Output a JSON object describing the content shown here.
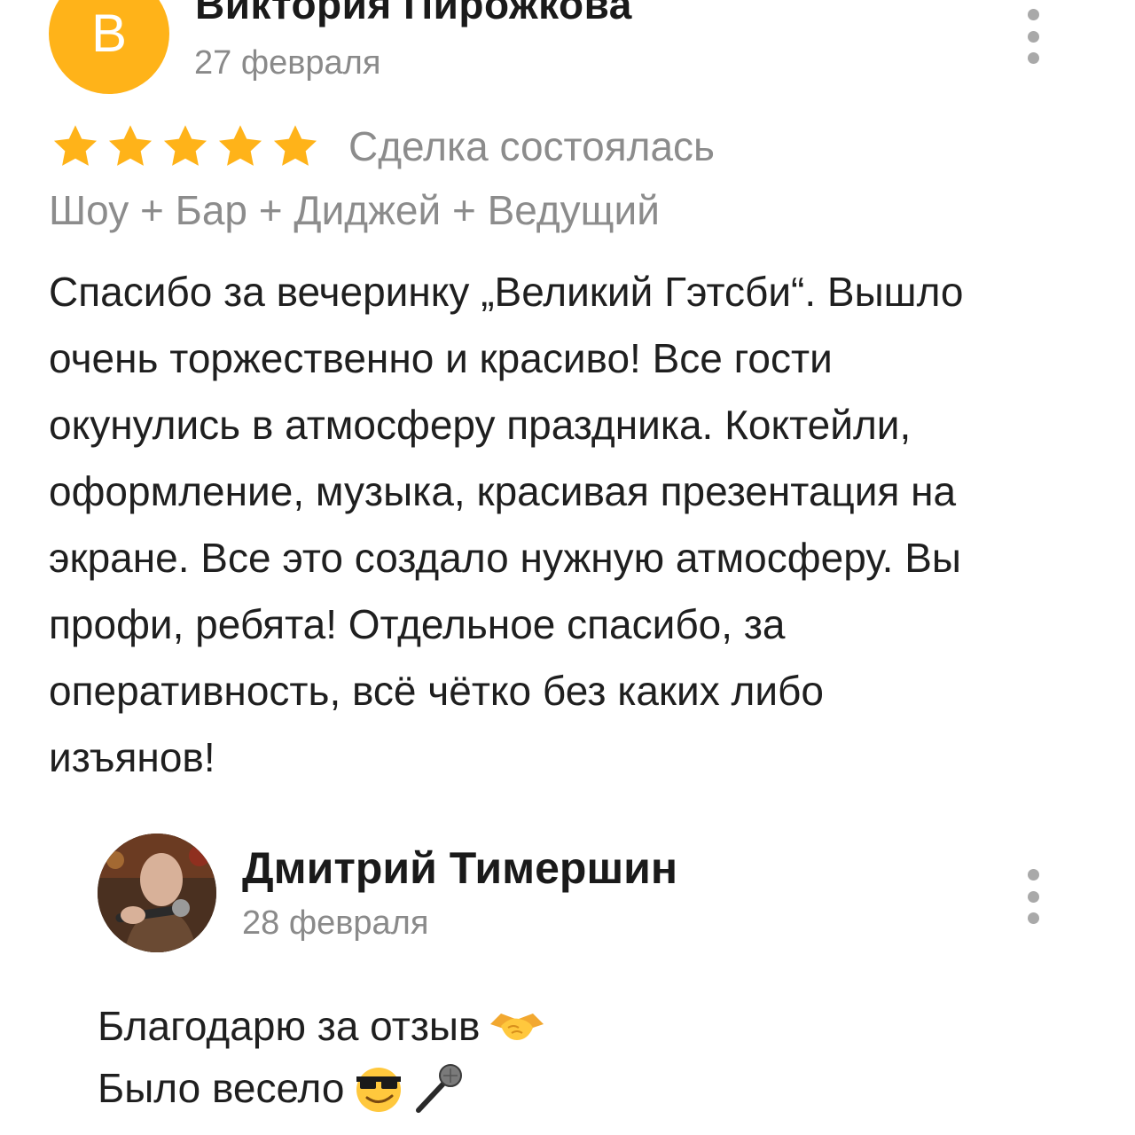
{
  "review": {
    "avatar_letter": "В",
    "author_name": "Виктория Пирожкова",
    "date": "27 февраля",
    "rating": 5,
    "deal_status": "Сделка состоялась",
    "service": "Шоу + Бар + Диджей + Ведущий",
    "text": "Спасибо за вечеринку „Великий Гэтсби“. Вышло\nочень торжественно и красиво! Все гости\nокунулись в атмосферу праздника. Коктейли,\nоформление, музыка, красивая презентация на\nэкране. Все это создало нужную атмосферу. Вы\nпрофи, ребята! Отдельное спасибо, за\nоперативность, всё чётко без каких либо\nизъянов!"
  },
  "reply": {
    "author_name": "Дмитрий Тимершин",
    "date": "28 февраля",
    "line1": "Благодарю за отзыв",
    "line2": "Было весело",
    "line1_emoji": "handshake-emoji",
    "line2_emojis": [
      "sunglasses-smile-emoji",
      "microphone-emoji"
    ]
  },
  "colors": {
    "avatar_bg": "#ffb319",
    "star": "#ffb319",
    "muted_text": "#8c8c8c",
    "primary_text": "#1f1f1f",
    "menu_dots": "#a9a9a9"
  },
  "icons": {
    "more_menu": "more-vertical-icon",
    "rating_star": "star-icon"
  }
}
